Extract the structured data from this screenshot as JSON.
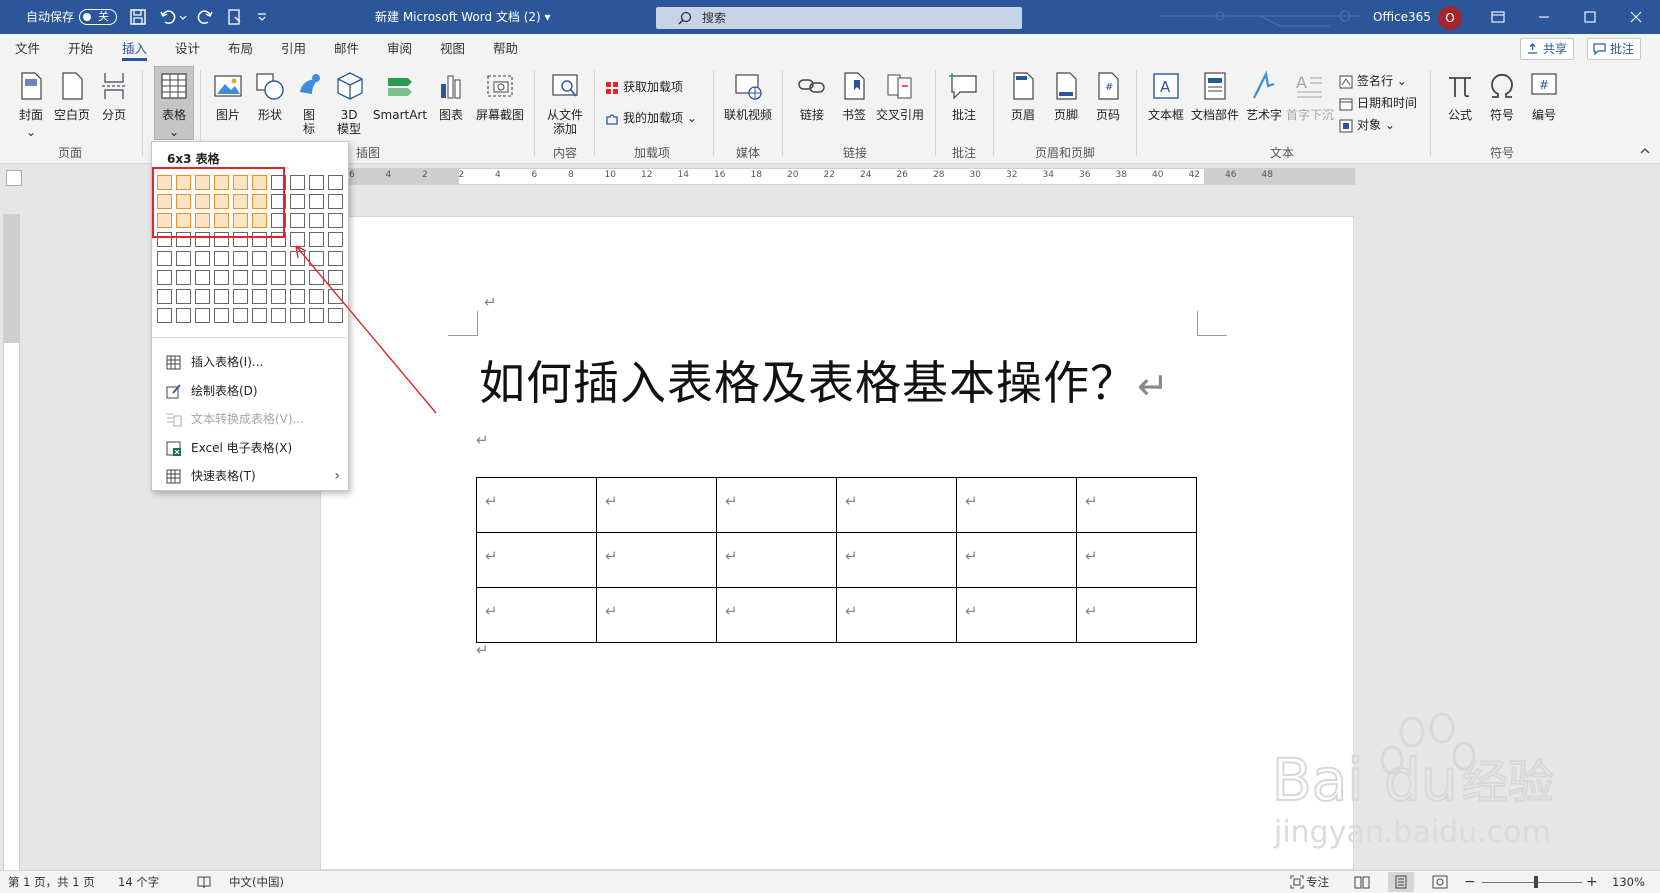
{
  "titlebar": {
    "autosave_label": "自动保存",
    "autosave_state": "关",
    "doc_title": "新建 Microsoft Word 文档 (2) ▾",
    "search_placeholder": "搜索",
    "account": "Office365",
    "avatar_initial": "O"
  },
  "tabs": [
    "文件",
    "开始",
    "插入",
    "设计",
    "布局",
    "引用",
    "邮件",
    "审阅",
    "视图",
    "帮助"
  ],
  "active_tab": "插入",
  "actions": {
    "share": "共享",
    "comments": "批注"
  },
  "ribbon": {
    "page_group": {
      "label": "页面",
      "cover": "封面",
      "blank": "空白页",
      "break": "分页"
    },
    "table_group": {
      "table": "表格"
    },
    "illustrations_group": {
      "label": "插图",
      "picture": "图片",
      "shapes": "形状",
      "icons_line1": "图",
      "icons_line2": "标",
      "model_line1": "3D",
      "model_line2": "模型",
      "smartart": "SmartArt",
      "chart": "图表",
      "screenshot": "屏幕截图"
    },
    "content_group": {
      "label": "内容",
      "from_file_line1": "从文件",
      "from_file_line2": "添加"
    },
    "addins_group": {
      "label": "加载项",
      "get": "获取加载项",
      "my": "我的加载项"
    },
    "media_group": {
      "label": "媒体",
      "online_video": "联机视频"
    },
    "links_group": {
      "label": "链接",
      "link": "链接",
      "bookmark": "书签",
      "crossref": "交叉引用"
    },
    "comments_group": {
      "label": "批注",
      "comment": "批注"
    },
    "header_footer_group": {
      "label": "页眉和页脚",
      "header": "页眉",
      "footer": "页脚",
      "page_number": "页码"
    },
    "text_group": {
      "label": "文本",
      "textbox": "文本框",
      "quickparts": "文档部件",
      "wordart": "艺术字",
      "dropcap": "首字下沉",
      "signature": "签名行",
      "datetime": "日期和时间",
      "object": "对象"
    },
    "symbols_group": {
      "label": "符号",
      "equation": "公式",
      "symbol": "符号",
      "number": "编号"
    }
  },
  "ruler": {
    "ticks": [
      "6",
      "4",
      "2",
      "2",
      "4",
      "6",
      "8",
      "10",
      "12",
      "14",
      "16",
      "18",
      "20",
      "22",
      "24",
      "26",
      "28",
      "30",
      "32",
      "34",
      "36",
      "38",
      "40",
      "42",
      "46",
      "48"
    ]
  },
  "document": {
    "title": "如何插入表格及表格基本操作？",
    "para_mark": "↵",
    "table": {
      "rows": 3,
      "cols": 6
    }
  },
  "table_dropdown": {
    "header": "6x3 表格",
    "grid": {
      "cols": 10,
      "rows": 8,
      "selected_cols": 6,
      "selected_rows": 3
    },
    "items": [
      {
        "label": "插入表格(I)...",
        "icon": "insert-table-icon",
        "disabled": false
      },
      {
        "label": "绘制表格(D)",
        "icon": "draw-table-icon",
        "disabled": false
      },
      {
        "label": "文本转换成表格(V)...",
        "icon": "text-to-table-icon",
        "disabled": true
      },
      {
        "label": "Excel 电子表格(X)",
        "icon": "excel-icon",
        "disabled": false
      },
      {
        "label": "快速表格(T)",
        "icon": "quick-table-icon",
        "disabled": false
      }
    ]
  },
  "statusbar": {
    "page": "第 1 页，共 1 页",
    "words": "14 个字",
    "language": "中文(中国)",
    "focus": "专注",
    "zoom": "130%"
  },
  "watermark": {
    "brand": "Bai",
    "brand2": "du",
    "cn": "经验",
    "url": "jingyan.baidu.com"
  },
  "colors": {
    "titlebar": "#2b579a",
    "highlight_cell": "#fbe3c6",
    "highlight_border": "#ef8c2b",
    "annotation": "#e0262c"
  }
}
